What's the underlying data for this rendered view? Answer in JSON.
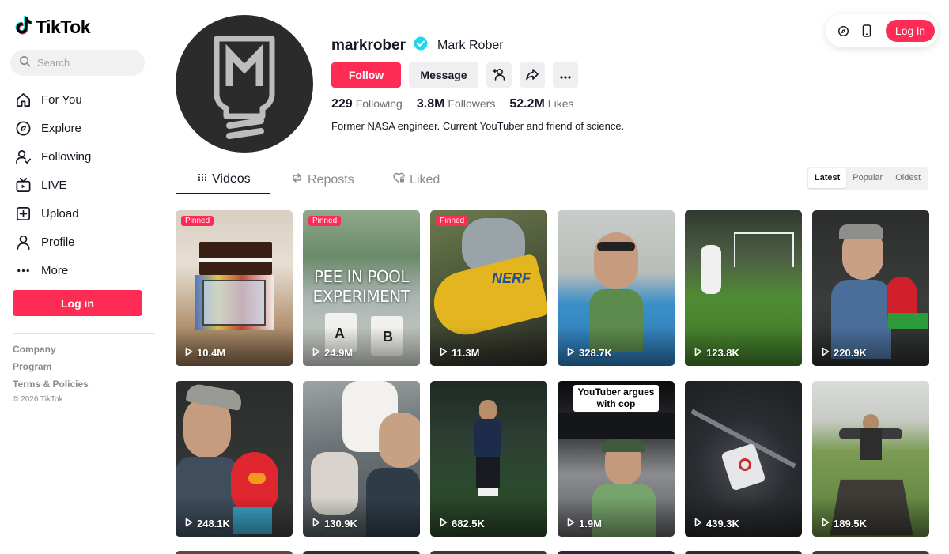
{
  "app": {
    "logo_text": "TikTok"
  },
  "search": {
    "placeholder": "Search"
  },
  "nav": {
    "items": [
      {
        "label": "For You",
        "icon": "home-icon"
      },
      {
        "label": "Explore",
        "icon": "compass-icon"
      },
      {
        "label": "Following",
        "icon": "following-icon"
      },
      {
        "label": "LIVE",
        "icon": "live-icon"
      },
      {
        "label": "Upload",
        "icon": "upload-icon"
      },
      {
        "label": "Profile",
        "icon": "profile-icon"
      },
      {
        "label": "More",
        "icon": "more-icon"
      }
    ],
    "login_label": "Log in"
  },
  "footer": {
    "links": [
      "Company",
      "Program",
      "Terms & Policies"
    ],
    "copyright": "© 2026 TikTok"
  },
  "topbar": {
    "login_label": "Log in"
  },
  "profile": {
    "username": "markrober",
    "nickname": "Mark Rober",
    "verified": true,
    "follow_label": "Follow",
    "message_label": "Message",
    "stats": {
      "following_count": "229",
      "following_label": "Following",
      "followers_count": "3.8M",
      "followers_label": "Followers",
      "likes_count": "52.2M",
      "likes_label": "Likes"
    },
    "bio": "Former NASA engineer. Current YouTuber and friend of science."
  },
  "tabs": {
    "videos": "Videos",
    "reposts": "Reposts",
    "liked": "Liked",
    "sort_options": [
      "Latest",
      "Popular",
      "Oldest"
    ],
    "active_sort": "Latest"
  },
  "colors": {
    "accent": "#fe2c55",
    "verified": "#20d5ec",
    "text": "#161823"
  },
  "videos": [
    {
      "views": "10.4M",
      "pinned": "Pinned"
    },
    {
      "views": "24.9M",
      "pinned": "Pinned",
      "overlay": "PEE IN POOL EXPERIMENT"
    },
    {
      "views": "11.3M",
      "pinned": "Pinned"
    },
    {
      "views": "328.7K"
    },
    {
      "views": "123.8K"
    },
    {
      "views": "220.9K"
    },
    {
      "views": "248.1K"
    },
    {
      "views": "130.9K"
    },
    {
      "views": "682.5K"
    },
    {
      "views": "1.9M",
      "caption": "YouTuber argues with cop"
    },
    {
      "views": "439.3K"
    },
    {
      "views": "189.5K"
    }
  ]
}
